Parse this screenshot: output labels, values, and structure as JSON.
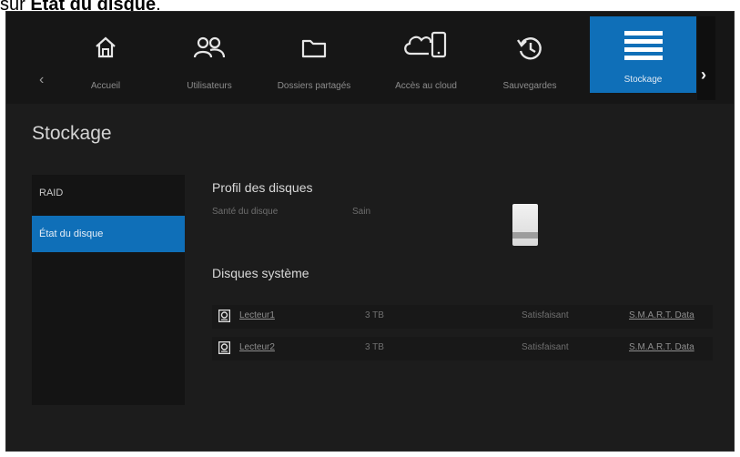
{
  "caption": {
    "prefix": "sur ",
    "bold": "État du disque",
    "suffix": "."
  },
  "nav": {
    "items": [
      {
        "label": "Accueil",
        "icon": "home-icon"
      },
      {
        "label": "Utilisateurs",
        "icon": "users-icon"
      },
      {
        "label": "Dossiers partagés",
        "icon": "folder-icon"
      },
      {
        "label": "Accès au cloud",
        "icon": "cloud-device-icon"
      },
      {
        "label": "Sauvegardes",
        "icon": "backup-icon"
      },
      {
        "label": "Stockage",
        "icon": "storage-icon",
        "active": true
      }
    ],
    "prev": "‹",
    "next": "›"
  },
  "page": {
    "title": "Stockage"
  },
  "sidebar": {
    "items": [
      {
        "label": "RAID"
      },
      {
        "label": "État du disque",
        "active": true
      }
    ]
  },
  "profile": {
    "title": "Profil des disques",
    "health_label": "Santé du disque",
    "health_value": "Sain"
  },
  "system_disks": {
    "title": "Disques système",
    "rows": [
      {
        "name": "Lecteur1",
        "size": "3 TB",
        "status": "Satisfaisant",
        "link": "S.M.A.R.T. Data"
      },
      {
        "name": "Lecteur2",
        "size": "3 TB",
        "status": "Satisfaisant",
        "link": "S.M.A.R.T. Data"
      }
    ]
  },
  "colors": {
    "accent": "#0f6fb8",
    "background": "#1c1c1c"
  }
}
